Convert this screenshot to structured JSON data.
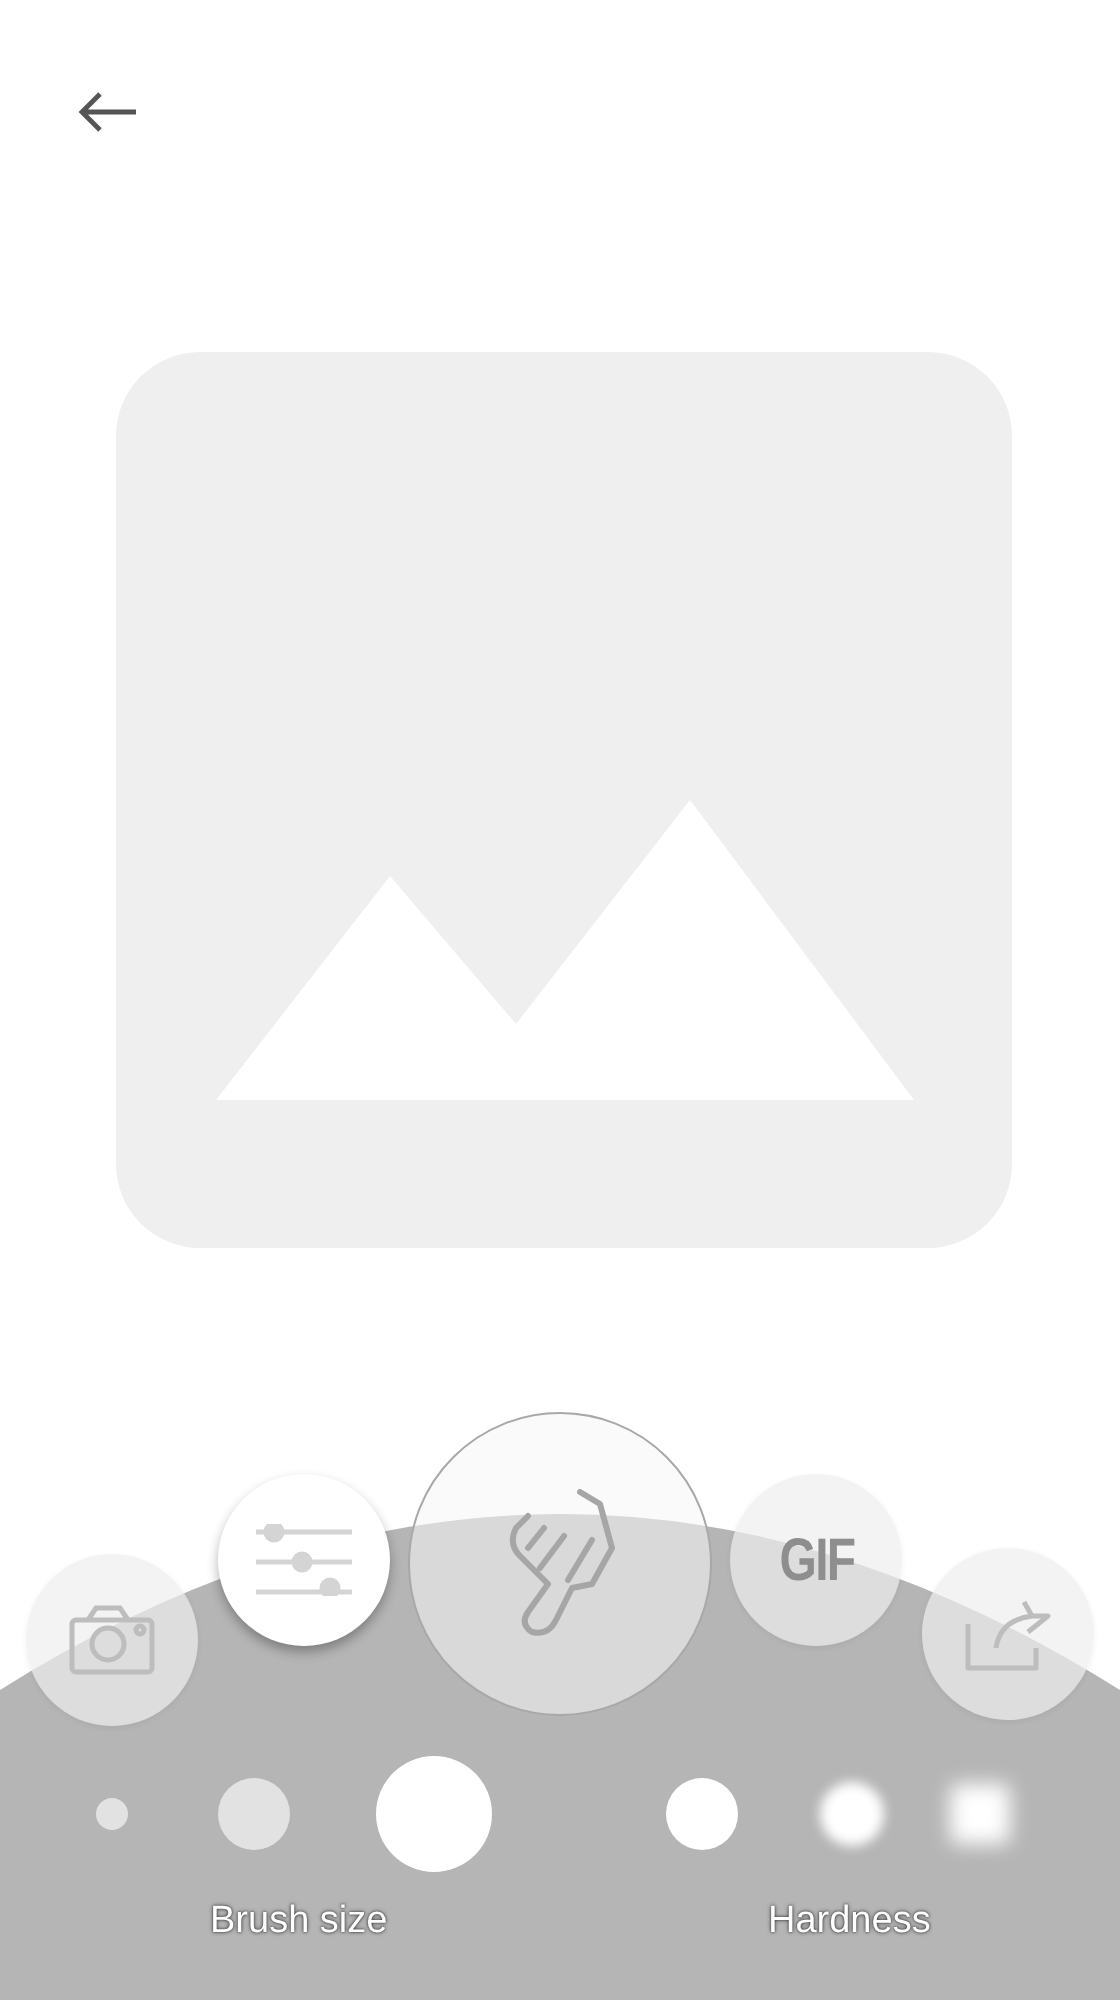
{
  "tools": [
    {
      "kind": "camera",
      "selected": false
    },
    {
      "kind": "adjust",
      "selected": true
    },
    {
      "kind": "touch",
      "selected": false
    },
    {
      "kind": "gif",
      "label": "GIF",
      "selected": false
    },
    {
      "kind": "share",
      "selected": false
    }
  ],
  "brush_sizes": [
    {
      "kind": "small",
      "selected": false
    },
    {
      "kind": "medium",
      "selected": false
    },
    {
      "kind": "large",
      "selected": true
    }
  ],
  "hardness": [
    {
      "kind": "hard"
    },
    {
      "kind": "soft"
    },
    {
      "kind": "softer"
    }
  ],
  "labels": {
    "brush_size": "Brush size",
    "hardness": "Hardness"
  }
}
